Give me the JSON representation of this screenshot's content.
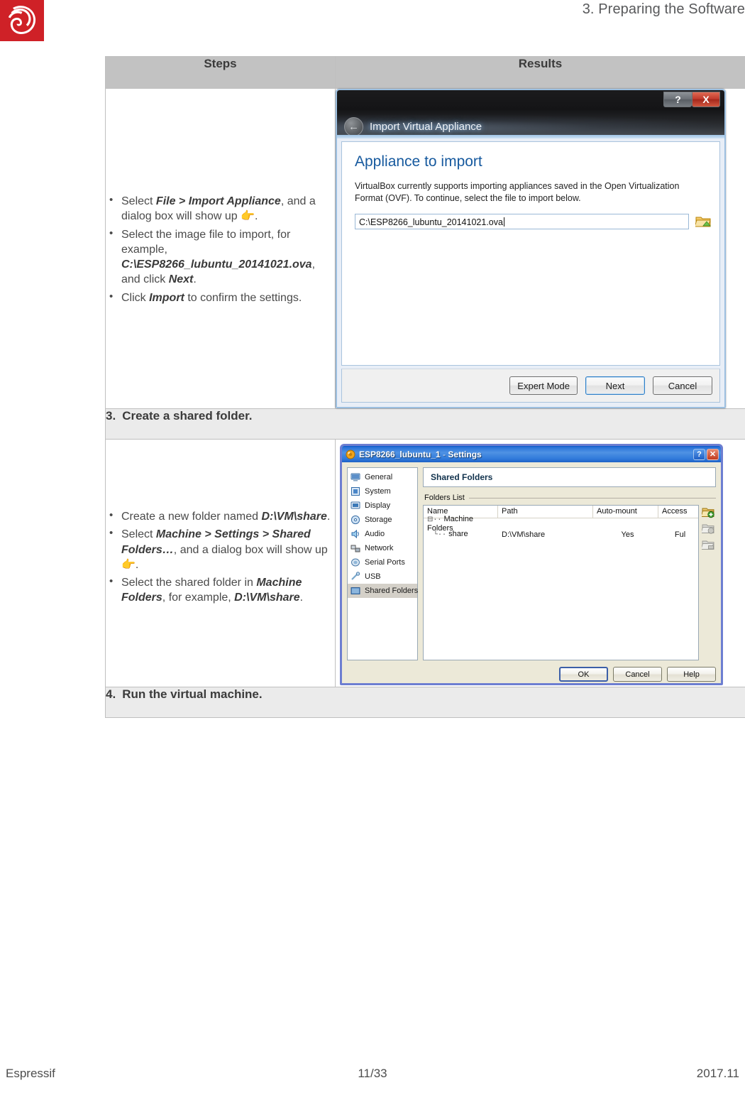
{
  "header": {
    "section_title": "3. Preparing the Software",
    "logo_name": "espressif-logo"
  },
  "table": {
    "columns": [
      "Steps",
      "Results"
    ],
    "rows": [
      {
        "type": "steps",
        "bullets": [
          {
            "parts": [
              {
                "t": "Select ",
                "b": false
              },
              {
                "t": "File > Import Appliance",
                "b": true
              },
              {
                "t": ", and a dialog box will show up ",
                "b": false
              },
              {
                "t": "👉",
                "b": false,
                "icon": true
              },
              {
                "t": ".",
                "b": false
              }
            ]
          },
          {
            "parts": [
              {
                "t": "Select the image file to import, for example, ",
                "b": false
              },
              {
                "t": "C:\\ESP8266_lubuntu_20141021.ova",
                "b": true
              },
              {
                "t": ", and click ",
                "b": false
              },
              {
                "t": "Next",
                "b": true
              },
              {
                "t": ".",
                "b": false
              }
            ]
          },
          {
            "parts": [
              {
                "t": "Click ",
                "b": false
              },
              {
                "t": "Import",
                "b": true
              },
              {
                "t": " to confirm the settings.",
                "b": false
              }
            ]
          }
        ]
      },
      {
        "type": "section",
        "number": "3.",
        "label": "Create a shared folder."
      },
      {
        "type": "steps",
        "bullets": [
          {
            "parts": [
              {
                "t": "Create a new folder named ",
                "b": false
              },
              {
                "t": "D:\\VM\\share",
                "b": true
              },
              {
                "t": ".",
                "b": false
              }
            ]
          },
          {
            "parts": [
              {
                "t": "Select ",
                "b": false
              },
              {
                "t": "Machine > Settings > Shared Folders…",
                "b": true
              },
              {
                "t": ", and a dialog box will show up ",
                "b": false
              },
              {
                "t": "👉",
                "b": false,
                "icon": true
              },
              {
                "t": ".",
                "b": false
              }
            ]
          },
          {
            "parts": [
              {
                "t": "Select the shared folder in ",
                "b": false
              },
              {
                "t": "Machine Folders",
                "b": true
              },
              {
                "t": ", for example, ",
                "b": false
              },
              {
                "t": "D:\\VM\\share",
                "b": true
              },
              {
                "t": ".",
                "b": false
              }
            ]
          }
        ]
      },
      {
        "type": "section",
        "number": "4.",
        "label": "Run the virtual machine."
      }
    ]
  },
  "import_dialog": {
    "window_title": "Import Virtual Appliance",
    "help_button": "?",
    "close_button": "X",
    "back_icon": "back-arrow-icon",
    "heading": "Appliance to import",
    "description": "VirtualBox currently supports importing appliances saved in the Open Virtualization Format (OVF). To continue, select the file to import below.",
    "path_value": "C:\\ESP8266_lubuntu_20141021.ova",
    "browse_icon": "open-folder-icon",
    "buttons": [
      {
        "label": "Expert Mode",
        "default": false
      },
      {
        "label": "Next",
        "default": true
      },
      {
        "label": "Cancel",
        "default": false
      }
    ]
  },
  "settings_dialog": {
    "title_main": "ESP8266_lubuntu_1",
    "title_sep": " - ",
    "title_sub": "Settings",
    "help_button": "?",
    "close_button": "✕",
    "sidebar": [
      {
        "label": "General",
        "icon": "monitor-icon",
        "selected": false
      },
      {
        "label": "System",
        "icon": "chip-icon",
        "selected": false
      },
      {
        "label": "Display",
        "icon": "display-icon",
        "selected": false
      },
      {
        "label": "Storage",
        "icon": "disc-icon",
        "selected": false
      },
      {
        "label": "Audio",
        "icon": "speaker-icon",
        "selected": false
      },
      {
        "label": "Network",
        "icon": "network-icon",
        "selected": false
      },
      {
        "label": "Serial Ports",
        "icon": "serial-port-icon",
        "selected": false
      },
      {
        "label": "USB",
        "icon": "usb-icon",
        "selected": false
      },
      {
        "label": "Shared Folders",
        "icon": "folder-icon",
        "selected": true
      }
    ],
    "pane_title": "Shared Folders",
    "group_label": "Folders List",
    "list_columns": [
      "Name",
      "Path",
      "Auto-mount",
      "Access"
    ],
    "list_rows": [
      {
        "name": "Machine Folders",
        "path": "",
        "auto": "",
        "access": "",
        "group": true
      },
      {
        "name": "share",
        "path": "D:\\VM\\share",
        "auto": "Yes",
        "access": "Ful",
        "group": false
      }
    ],
    "tool_icons": [
      "add-shared-folder-icon",
      "edit-shared-folder-icon",
      "remove-shared-folder-icon"
    ],
    "buttons": [
      {
        "label": "OK",
        "default": true
      },
      {
        "label": "Cancel",
        "default": false
      },
      {
        "label": "Help",
        "default": false
      }
    ]
  },
  "footer": {
    "left": "Espressif",
    "center": "11/33",
    "right": "2017.11"
  }
}
